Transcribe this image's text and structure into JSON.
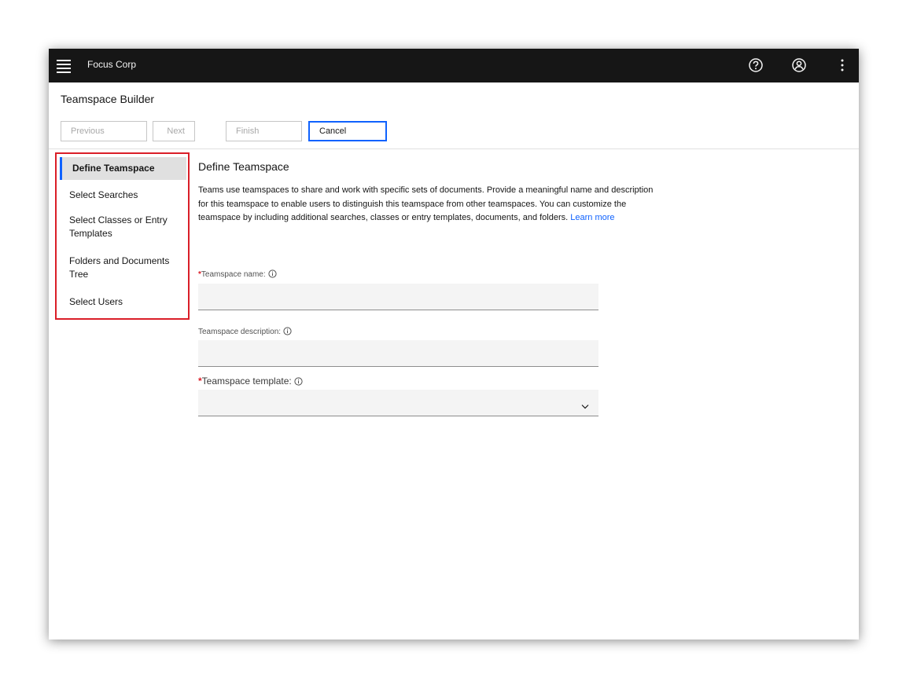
{
  "topbar": {
    "brand": "Focus Corp",
    "icons": [
      "menu-icon",
      "help-icon",
      "user-icon",
      "overflow-menu-icon"
    ]
  },
  "app": {
    "title": "Teamspace Builder"
  },
  "toolbar": {
    "previous_label": "Previous",
    "next_label": "Next",
    "finish_label": "Finish",
    "cancel_label": "Cancel"
  },
  "sidebar": {
    "items": [
      {
        "label": "Define Teamspace",
        "active": true
      },
      {
        "label": "Select Searches"
      },
      {
        "label": "Select Classes or Entry Templates"
      },
      {
        "label": "Folders and Documents Tree"
      },
      {
        "label": "Select Users"
      }
    ]
  },
  "main": {
    "section_title": "Define Teamspace",
    "description": "Teams use teamspaces to share and work with specific sets of documents. Provide a meaningful name and description for this teamspace to enable users to distinguish this teamspace from other teamspaces. You can customize the teamspace by including additional searches, classes or entry templates, documents, and folders.",
    "learn_more": "Learn more",
    "name_label": "Teamspace name:",
    "name_value": "",
    "description_label": "Teamspace description:",
    "description_value": "",
    "template_label": "Teamspace template:",
    "template_value": "",
    "required_marker": "*"
  },
  "colors": {
    "topbar": "#161616",
    "accent": "#0f62fe",
    "required": "#da1e28",
    "highlight_border": "#da1e28"
  }
}
